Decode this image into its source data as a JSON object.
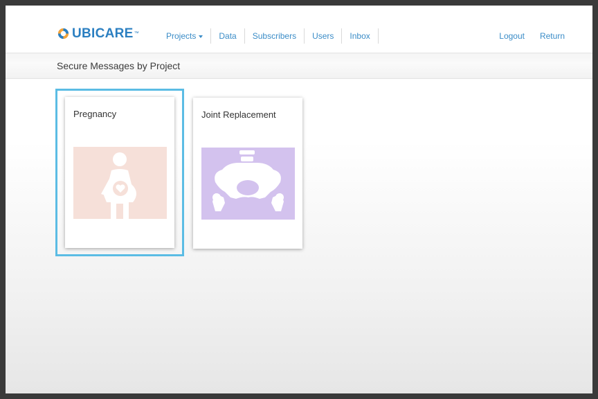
{
  "brand": {
    "name": "UbiCare",
    "logo_text": "UBICARE",
    "tm": "™",
    "colors": {
      "blue": "#2b7fc1",
      "orange": "#f2a33a"
    }
  },
  "nav": {
    "items": [
      {
        "label": "Projects",
        "has_dropdown": true
      },
      {
        "label": "Data"
      },
      {
        "label": "Subscribers"
      },
      {
        "label": "Users"
      },
      {
        "label": "Inbox"
      }
    ],
    "right": [
      {
        "label": "Logout"
      },
      {
        "label": "Return"
      }
    ]
  },
  "page": {
    "title": "Secure Messages by Project"
  },
  "projects": [
    {
      "title": "Pregnancy",
      "icon": "pregnant-woman-icon",
      "image_bg": "#f6e0d9",
      "selected": true
    },
    {
      "title": "Joint Replacement",
      "icon": "pelvis-hip-icon",
      "image_bg": "#d3c2ee",
      "selected": false
    }
  ],
  "colors": {
    "link": "#3a8cc7",
    "selection_border": "#5bbce4"
  }
}
